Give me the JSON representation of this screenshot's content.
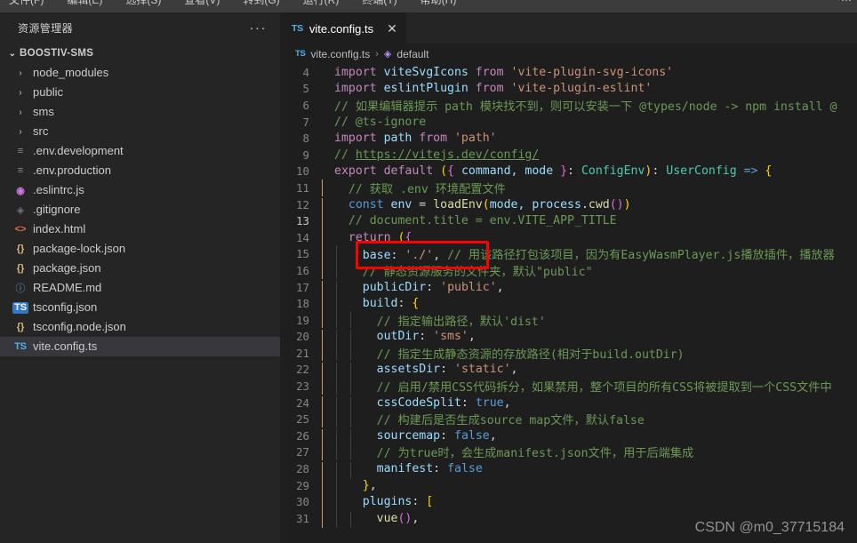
{
  "menubar": {
    "items": [
      "文件(F)",
      "编辑(E)",
      "选择(S)",
      "查看(V)",
      "转到(G)",
      "运行(R)",
      "终端(T)",
      "帮助(H)"
    ],
    "right": "⋯"
  },
  "sidebar": {
    "title": "资源管理器",
    "more_label": "···",
    "root": {
      "label": "BOOSTIV-SMS",
      "chevron": "chevron-down"
    },
    "items": [
      {
        "label": "node_modules",
        "kind": "folder",
        "icon": "chevron-right-icon",
        "glyph": "›"
      },
      {
        "label": "public",
        "kind": "folder",
        "icon": "chevron-right-icon",
        "glyph": "›"
      },
      {
        "label": "sms",
        "kind": "folder",
        "icon": "chevron-right-icon",
        "glyph": "›"
      },
      {
        "label": "src",
        "kind": "folder",
        "icon": "chevron-right-icon",
        "glyph": "›"
      },
      {
        "label": ".env.development",
        "kind": "file",
        "icon": "env-file-icon",
        "glyph": "≡",
        "cls": "ic-env"
      },
      {
        "label": ".env.production",
        "kind": "file",
        "icon": "env-file-icon",
        "glyph": "≡",
        "cls": "ic-env"
      },
      {
        "label": ".eslintrc.js",
        "kind": "file",
        "icon": "eslint-icon",
        "glyph": "◉",
        "cls": "ic-eslint"
      },
      {
        "label": ".gitignore",
        "kind": "file",
        "icon": "git-icon",
        "glyph": "◈",
        "cls": "ic-git"
      },
      {
        "label": "index.html",
        "kind": "file",
        "icon": "html-icon",
        "glyph": "<>",
        "cls": "ic-html"
      },
      {
        "label": "package-lock.json",
        "kind": "file",
        "icon": "json-icon",
        "glyph": "{}",
        "cls": "ic-json"
      },
      {
        "label": "package.json",
        "kind": "file",
        "icon": "json-icon",
        "glyph": "{}",
        "cls": "ic-json"
      },
      {
        "label": "README.md",
        "kind": "file",
        "icon": "info-icon",
        "glyph": "ⓘ",
        "cls": "ic-md"
      },
      {
        "label": "tsconfig.json",
        "kind": "file",
        "icon": "typescript-config-icon",
        "glyph": "TS",
        "cls": "ic-tsjson"
      },
      {
        "label": "tsconfig.node.json",
        "kind": "file",
        "icon": "json-icon",
        "glyph": "{}",
        "cls": "ic-json"
      },
      {
        "label": "vite.config.ts",
        "kind": "file",
        "icon": "typescript-icon",
        "glyph": "TS",
        "cls": "ic-ts",
        "selected": true
      }
    ]
  },
  "editor": {
    "tab": {
      "icon": "typescript-icon",
      "icon_glyph": "TS",
      "name": "vite.config.ts",
      "close": "✕"
    },
    "breadcrumb": {
      "file_icon_glyph": "TS",
      "file": "vite.config.ts",
      "separator": "›",
      "symbol_icon": "cube-icon",
      "symbol_glyph": "◆",
      "symbol": "default"
    },
    "first_line_number": 4,
    "annotation": {
      "color": "#ff0000",
      "target_line": 15,
      "label": "red-highlight-box"
    },
    "watermark": "CSDN @m0_37715184",
    "lines": [
      {
        "n": 4,
        "tokens": [
          {
            "t": "import ",
            "c": "k"
          },
          {
            "t": "viteSvgIcons",
            "c": "id"
          },
          {
            "t": " from ",
            "c": "k"
          },
          {
            "t": "'vite-plugin-svg-icons'",
            "c": "st"
          }
        ]
      },
      {
        "n": 5,
        "tokens": [
          {
            "t": "import ",
            "c": "k"
          },
          {
            "t": "eslintPlugin",
            "c": "id"
          },
          {
            "t": " from ",
            "c": "k"
          },
          {
            "t": "'vite-plugin-eslint'",
            "c": "st"
          }
        ]
      },
      {
        "n": 6,
        "tokens": [
          {
            "t": "// 如果编辑器提示 path 模块找不到，则可以安装一下 @types/node -> npm install @",
            "c": "cm"
          }
        ]
      },
      {
        "n": 7,
        "tokens": [
          {
            "t": "// @ts-ignore",
            "c": "cm"
          }
        ]
      },
      {
        "n": 8,
        "tokens": [
          {
            "t": "import ",
            "c": "k"
          },
          {
            "t": "path",
            "c": "id"
          },
          {
            "t": " from ",
            "c": "k"
          },
          {
            "t": "'path'",
            "c": "st"
          }
        ]
      },
      {
        "n": 9,
        "tokens": [
          {
            "t": "// ",
            "c": "cm"
          },
          {
            "t": "https://vitejs.dev/config/",
            "c": "lnk"
          }
        ]
      },
      {
        "n": 10,
        "indent": 0,
        "tokens": [
          {
            "t": "export default ",
            "c": "k"
          },
          {
            "t": "(",
            "c": "br1"
          },
          {
            "t": "{",
            "c": "br2"
          },
          {
            "t": " command, mode ",
            "c": "id"
          },
          {
            "t": "}",
            "c": "br2"
          },
          {
            "t": ": ",
            "c": "pn"
          },
          {
            "t": "ConfigEnv",
            "c": "ty"
          },
          {
            "t": ")",
            "c": "br1"
          },
          {
            "t": ": ",
            "c": "pn"
          },
          {
            "t": "UserConfig",
            "c": "ty"
          },
          {
            "t": " => ",
            "c": "kb"
          },
          {
            "t": "{",
            "c": "br1"
          }
        ]
      },
      {
        "n": 11,
        "indent": 1,
        "tokens": [
          {
            "t": "  // 获取 .env 环境配置文件",
            "c": "cm"
          }
        ]
      },
      {
        "n": 12,
        "indent": 1,
        "tokens": [
          {
            "t": "  ",
            "c": "pn"
          },
          {
            "t": "const",
            "c": "kb"
          },
          {
            "t": " env",
            "c": "id"
          },
          {
            "t": " = ",
            "c": "pn"
          },
          {
            "t": "loadEnv",
            "c": "fn"
          },
          {
            "t": "(",
            "c": "br1"
          },
          {
            "t": "mode, ",
            "c": "id"
          },
          {
            "t": "process",
            "c": "id"
          },
          {
            "t": ".",
            "c": "pn"
          },
          {
            "t": "cwd",
            "c": "fn"
          },
          {
            "t": "(",
            "c": "br2"
          },
          {
            "t": ")",
            "c": "br2"
          },
          {
            "t": ")",
            "c": "br1"
          }
        ]
      },
      {
        "n": 13,
        "indent": 1,
        "tokens": [
          {
            "t": "  // document.title = env.VITE_APP_TITLE",
            "c": "cm"
          }
        ]
      },
      {
        "n": 14,
        "indent": 1,
        "tokens": [
          {
            "t": "  ",
            "c": "pn"
          },
          {
            "t": "return ",
            "c": "k"
          },
          {
            "t": "(",
            "c": "br1"
          },
          {
            "t": "{",
            "c": "br2"
          }
        ]
      },
      {
        "n": 15,
        "indent": 2,
        "tokens": [
          {
            "t": "    ",
            "c": "pn"
          },
          {
            "t": "base",
            "c": "id"
          },
          {
            "t": ": ",
            "c": "pn"
          },
          {
            "t": "'./'",
            "c": "st"
          },
          {
            "t": ", ",
            "c": "pn"
          },
          {
            "t": "// 用该路径打包该项目，因为有EasyWasmPlayer.js播放插件，播放器",
            "c": "cm"
          }
        ]
      },
      {
        "n": 16,
        "indent": 2,
        "tokens": [
          {
            "t": "    // 静态资源服务的文件夹，默认\"public\"",
            "c": "cm"
          }
        ]
      },
      {
        "n": 17,
        "indent": 2,
        "tokens": [
          {
            "t": "    ",
            "c": "pn"
          },
          {
            "t": "publicDir",
            "c": "id"
          },
          {
            "t": ": ",
            "c": "pn"
          },
          {
            "t": "'public'",
            "c": "st"
          },
          {
            "t": ",",
            "c": "pn"
          }
        ]
      },
      {
        "n": 18,
        "indent": 2,
        "tokens": [
          {
            "t": "    ",
            "c": "pn"
          },
          {
            "t": "build",
            "c": "id"
          },
          {
            "t": ": ",
            "c": "pn"
          },
          {
            "t": "{",
            "c": "br1"
          }
        ]
      },
      {
        "n": 19,
        "indent": 3,
        "tokens": [
          {
            "t": "      // 指定输出路径，默认'dist'",
            "c": "cm"
          }
        ]
      },
      {
        "n": 20,
        "indent": 3,
        "tokens": [
          {
            "t": "      ",
            "c": "pn"
          },
          {
            "t": "outDir",
            "c": "id"
          },
          {
            "t": ": ",
            "c": "pn"
          },
          {
            "t": "'sms'",
            "c": "st"
          },
          {
            "t": ",",
            "c": "pn"
          }
        ]
      },
      {
        "n": 21,
        "indent": 3,
        "tokens": [
          {
            "t": "      // 指定生成静态资源的存放路径(相对于build.outDir)",
            "c": "cm"
          }
        ]
      },
      {
        "n": 22,
        "indent": 3,
        "tokens": [
          {
            "t": "      ",
            "c": "pn"
          },
          {
            "t": "assetsDir",
            "c": "id"
          },
          {
            "t": ": ",
            "c": "pn"
          },
          {
            "t": "'static'",
            "c": "st"
          },
          {
            "t": ",",
            "c": "pn"
          }
        ]
      },
      {
        "n": 23,
        "indent": 3,
        "tokens": [
          {
            "t": "      // 启用/禁用CSS代码拆分，如果禁用，整个项目的所有CSS将被提取到一个CSS文件中",
            "c": "cm"
          }
        ]
      },
      {
        "n": 24,
        "indent": 3,
        "tokens": [
          {
            "t": "      ",
            "c": "pn"
          },
          {
            "t": "cssCodeSplit",
            "c": "id"
          },
          {
            "t": ": ",
            "c": "pn"
          },
          {
            "t": "true",
            "c": "kb"
          },
          {
            "t": ",",
            "c": "pn"
          }
        ]
      },
      {
        "n": 25,
        "indent": 3,
        "tokens": [
          {
            "t": "      // 构建后是否生成source map文件，默认false",
            "c": "cm"
          }
        ]
      },
      {
        "n": 26,
        "indent": 3,
        "tokens": [
          {
            "t": "      ",
            "c": "pn"
          },
          {
            "t": "sourcemap",
            "c": "id"
          },
          {
            "t": ": ",
            "c": "pn"
          },
          {
            "t": "false",
            "c": "kb"
          },
          {
            "t": ",",
            "c": "pn"
          }
        ]
      },
      {
        "n": 27,
        "indent": 3,
        "tokens": [
          {
            "t": "      // 为true时，会生成manifest.json文件，用于后端集成",
            "c": "cm"
          }
        ]
      },
      {
        "n": 28,
        "indent": 3,
        "tokens": [
          {
            "t": "      ",
            "c": "pn"
          },
          {
            "t": "manifest",
            "c": "id"
          },
          {
            "t": ": ",
            "c": "pn"
          },
          {
            "t": "false",
            "c": "kb"
          }
        ]
      },
      {
        "n": 29,
        "indent": 2,
        "tokens": [
          {
            "t": "    ",
            "c": "pn"
          },
          {
            "t": "}",
            "c": "br1"
          },
          {
            "t": ",",
            "c": "pn"
          }
        ]
      },
      {
        "n": 30,
        "indent": 2,
        "tokens": [
          {
            "t": "    ",
            "c": "pn"
          },
          {
            "t": "plugins",
            "c": "id"
          },
          {
            "t": ": ",
            "c": "pn"
          },
          {
            "t": "[",
            "c": "br1"
          }
        ]
      },
      {
        "n": 31,
        "indent": 3,
        "tokens": [
          {
            "t": "      ",
            "c": "pn"
          },
          {
            "t": "vue",
            "c": "fn"
          },
          {
            "t": "(",
            "c": "br2"
          },
          {
            "t": ")",
            "c": "br2"
          },
          {
            "t": ",",
            "c": "pn"
          }
        ]
      }
    ]
  },
  "colors": {
    "editor_bg": "#1e1e1e",
    "sidebar_bg": "#252526",
    "selection_bg": "#37373d",
    "annotation": "#ff0000",
    "accent_ts": "#4fb3e8"
  }
}
